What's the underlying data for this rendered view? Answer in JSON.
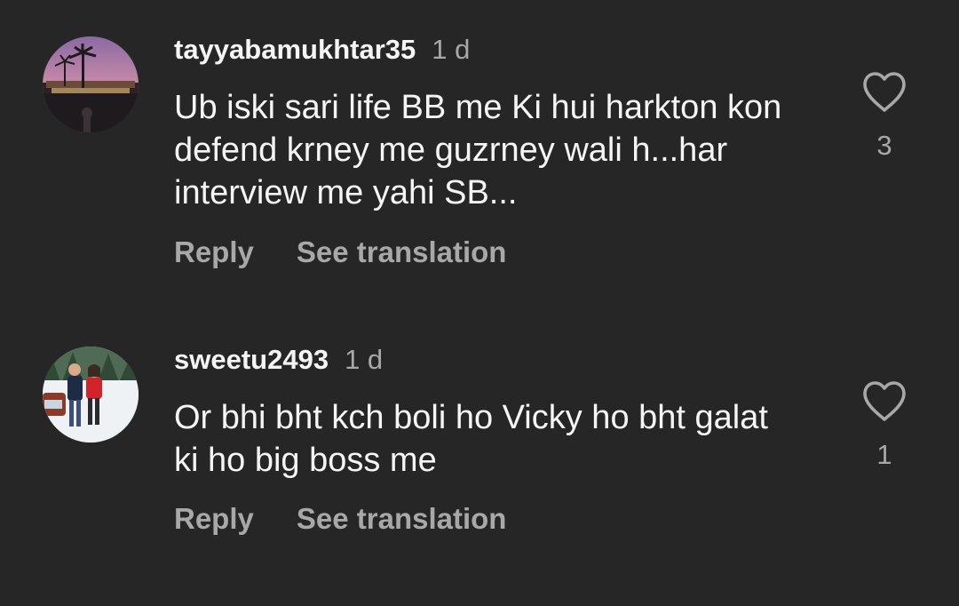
{
  "comments": [
    {
      "username": "tayyabamukhtar35",
      "time": "1 d",
      "text": "Ub iski sari life BB me Ki hui harkton kon defend krney me guzrney wali h...har interview me yahi SB...",
      "reply_label": "Reply",
      "translate_label": "See translation",
      "likes": "3",
      "avatar_icon": "palm-tree-sunset-photo"
    },
    {
      "username": "sweetu2493",
      "time": "1 d",
      "text": "Or bhi bht kch boli ho Vicky ho bht galat ki ho big boss me",
      "reply_label": "Reply",
      "translate_label": "See translation",
      "likes": "1",
      "avatar_icon": "couple-snow-photo"
    }
  ],
  "colors": {
    "background": "#262626",
    "primary_text": "#f5f5f5",
    "secondary_text": "#a8a8a8"
  },
  "icons": {
    "like": "heart-outline-icon"
  }
}
